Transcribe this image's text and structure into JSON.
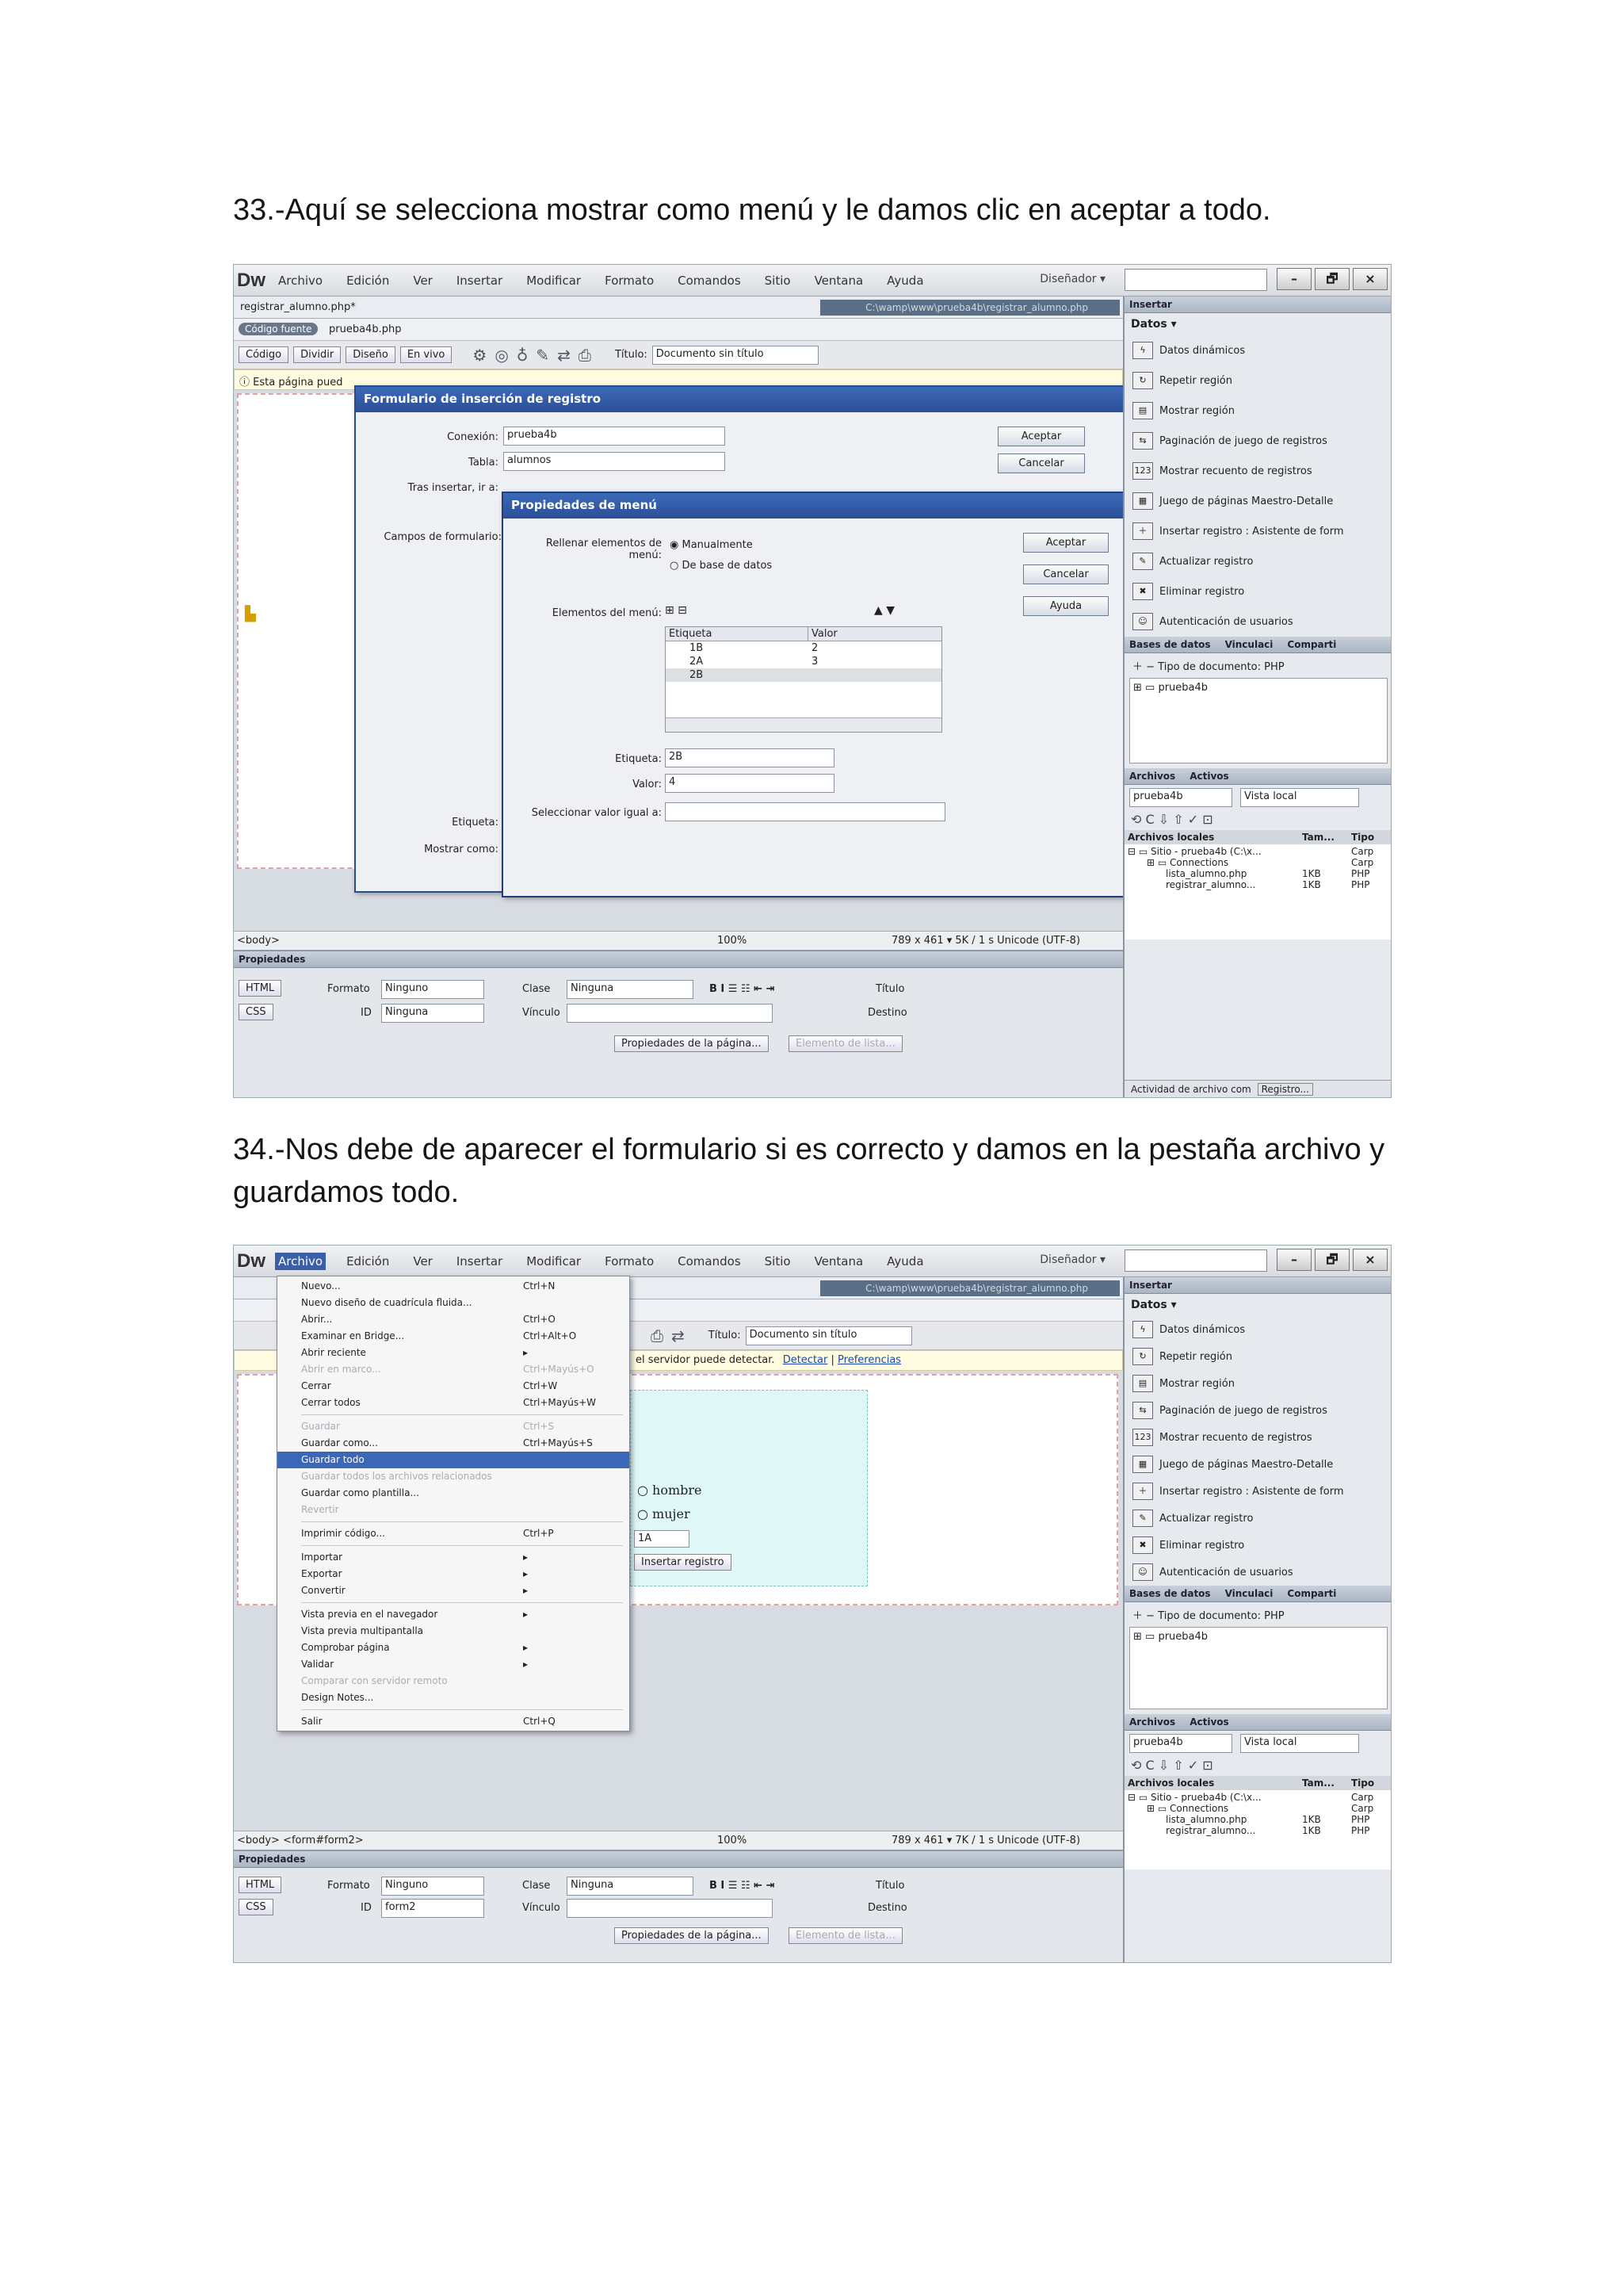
{
  "steps": [
    {
      "text": "33.-Aquí se selecciona mostrar como menú y le damos clic en aceptar a todo."
    },
    {
      "text": "34.-Nos debe de aparecer el formulario si es correcto y damos en la pestaña archivo y guardamos todo."
    }
  ],
  "app": {
    "logo": "Dw",
    "menus": [
      "Archivo",
      "Edición",
      "Ver",
      "Insertar",
      "Modificar",
      "Formato",
      "Comandos",
      "Sitio",
      "Ventana",
      "Ayuda"
    ],
    "workspace": "Diseñador ▾",
    "win_buttons": [
      "–",
      "🗗",
      "×"
    ],
    "doc_tab": "registrar_alumno.php*",
    "source_tag": "Código fuente",
    "source_file": "prueba4b.php",
    "path": "C:\\wamp\\www\\prueba4b\\registrar_alumno.php",
    "view_buttons": [
      "Código",
      "Dividir",
      "Diseño",
      "En vivo"
    ],
    "title_label": "Título:",
    "title_value": "Documento sin título",
    "info_text": "Esta página pued",
    "info_text_2": "el servidor puede detectar.",
    "info_link_1": "Detectar",
    "info_link_2": "Preferencias"
  },
  "insert_panel": {
    "tab_1": "Insertar",
    "section": "Datos ▾",
    "items": [
      "Datos dinámicos",
      "Repetir región",
      "Mostrar región",
      "Paginación de juego de registros",
      "Mostrar recuento de registros",
      "Juego de páginas Maestro-Detalle",
      "Insertar registro : Asistente de form",
      "Actualizar registro",
      "Eliminar registro",
      "Autenticación de usuarios"
    ],
    "db_tabs": [
      "Bases de datos",
      "Vinculaci",
      "Comparti"
    ],
    "doc_type": "Tipo de documento: PHP",
    "db_item": "prueba4b",
    "files_tabs": [
      "Archivos",
      "Activos"
    ],
    "site_select": "prueba4b",
    "view_select": "Vista local",
    "col_headers": [
      "Archivos locales",
      "Tam...",
      "Tipo"
    ],
    "tree": [
      {
        "name": "Sitio - prueba4b (C:\\x...",
        "size": "",
        "type": "Carp"
      },
      {
        "name": "Connections",
        "size": "",
        "type": "Carp"
      },
      {
        "name": "lista_alumno.php",
        "size": "1KB",
        "type": "PHP"
      },
      {
        "name": "registrar_alumno...",
        "size": "1KB",
        "type": "PHP"
      }
    ],
    "activity": "Actividad de archivo com",
    "activity_btn": "Registro..."
  },
  "status": {
    "tag_1": "<body>",
    "tag_2": "<body> <form#form2>",
    "zoom": "100%",
    "size_1": "789 x 461 ▾  5K / 1 s  Unicode (UTF-8)",
    "size_2": "789 x 461 ▾  7K / 1 s  Unicode (UTF-8)"
  },
  "properties": {
    "title": "Propiedades",
    "html_btn": "HTML",
    "css_btn": "CSS",
    "format_label": "Formato",
    "format_value": "Ninguno",
    "id_label": "ID",
    "id_value_1": "Ninguna",
    "id_value_2": "form2",
    "class_label": "Clase",
    "class_value": "Ninguna",
    "link_label": "Vínculo",
    "title_label": "Título",
    "target_label": "Destino",
    "page_props": "Propiedades de la página...",
    "list_item": "Elemento de lista..."
  },
  "insert_dialog": {
    "title": "Formulario de inserción de registro",
    "conexion_label": "Conexión:",
    "conexion_value": "prueba4b",
    "tabla_label": "Tabla:",
    "tabla_value": "alumnos",
    "tras_label": "Tras insertar, ir a:",
    "campos_label": "Campos de formulario:",
    "etiqueta_label": "Etiqueta:",
    "mostrar_label": "Mostrar como:",
    "ok": "Aceptar",
    "cancel": "Cancelar"
  },
  "menu_dialog": {
    "title": "Propiedades de menú",
    "rellenar_label": "Rellenar elementos de menú:",
    "radio_1": "Manualmente",
    "radio_2": "De base de datos",
    "elementos_label": "Elementos del menú:",
    "col_headers": [
      "Etiqueta",
      "Valor"
    ],
    "rows": [
      {
        "label": "1B",
        "value": "2"
      },
      {
        "label": "2A",
        "value": "3"
      },
      {
        "label": "2B",
        "value": ""
      }
    ],
    "etiqueta_label": "Etiqueta:",
    "etiqueta_value": "2B",
    "valor_label": "Valor:",
    "valor_value": "4",
    "seleccionar_label": "Seleccionar valor igual a:",
    "ok": "Aceptar",
    "cancel": "Cancelar",
    "help": "Ayuda"
  },
  "file_menu": {
    "items": [
      {
        "label": "Nuevo...",
        "shortcut": "Ctrl+N",
        "state": ""
      },
      {
        "label": "Nuevo diseño de cuadrícula fluida...",
        "shortcut": "",
        "state": ""
      },
      {
        "label": "Abrir...",
        "shortcut": "Ctrl+O",
        "state": ""
      },
      {
        "label": "Examinar en Bridge...",
        "shortcut": "Ctrl+Alt+O",
        "state": ""
      },
      {
        "label": "Abrir reciente",
        "shortcut": "▸",
        "state": ""
      },
      {
        "label": "Abrir en marco...",
        "shortcut": "Ctrl+Mayús+O",
        "state": "dis"
      },
      {
        "label": "Cerrar",
        "shortcut": "Ctrl+W",
        "state": ""
      },
      {
        "label": "Cerrar todos",
        "shortcut": "Ctrl+Mayús+W",
        "state": "",
        "sep": true
      },
      {
        "label": "Guardar",
        "shortcut": "Ctrl+S",
        "state": "dis"
      },
      {
        "label": "Guardar como...",
        "shortcut": "Ctrl+Mayús+S",
        "state": ""
      },
      {
        "label": "Guardar todo",
        "shortcut": "",
        "state": "sel"
      },
      {
        "label": "Guardar todos los archivos relacionados",
        "shortcut": "",
        "state": "dis"
      },
      {
        "label": "Guardar como plantilla...",
        "shortcut": "",
        "state": ""
      },
      {
        "label": "Revertir",
        "shortcut": "",
        "state": "dis",
        "sep": true
      },
      {
        "label": "Imprimir código...",
        "shortcut": "Ctrl+P",
        "state": "",
        "sep": true
      },
      {
        "label": "Importar",
        "shortcut": "▸",
        "state": ""
      },
      {
        "label": "Exportar",
        "shortcut": "▸",
        "state": ""
      },
      {
        "label": "Convertir",
        "shortcut": "▸",
        "state": "",
        "sep": true
      },
      {
        "label": "Vista previa en el navegador",
        "shortcut": "▸",
        "state": ""
      },
      {
        "label": "Vista previa multipantalla",
        "shortcut": "",
        "state": ""
      },
      {
        "label": "Comprobar página",
        "shortcut": "▸",
        "state": ""
      },
      {
        "label": "Validar",
        "shortcut": "▸",
        "state": ""
      },
      {
        "label": "Comparar con servidor remoto",
        "shortcut": "",
        "state": "dis"
      },
      {
        "label": "Design Notes...",
        "shortcut": "",
        "state": "",
        "sep": true
      },
      {
        "label": "Salir",
        "shortcut": "Ctrl+Q",
        "state": ""
      }
    ]
  },
  "form_preview": {
    "radio_1": "hombre",
    "radio_2": "mujer",
    "select": "1A",
    "submit": "Insertar registro"
  }
}
